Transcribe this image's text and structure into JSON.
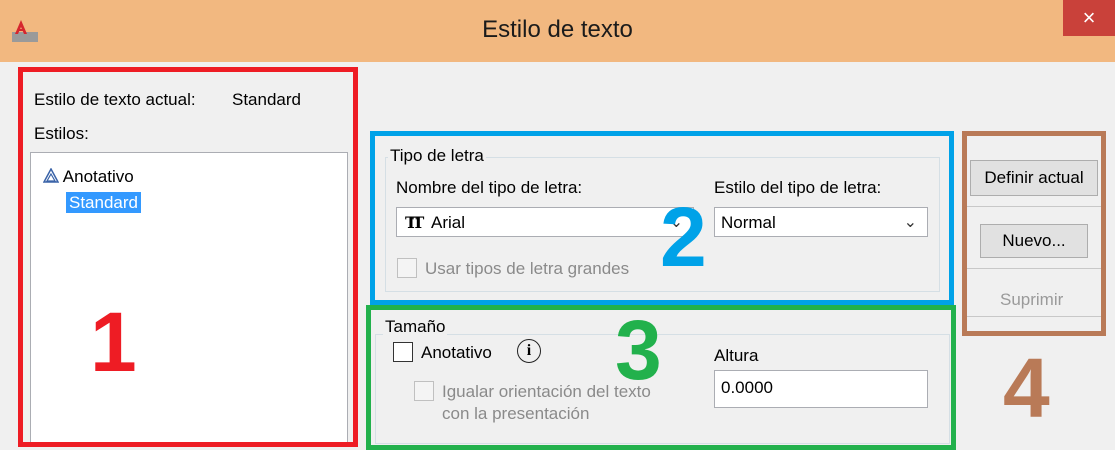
{
  "window": {
    "title": "Estilo de texto",
    "close": "×",
    "accent": "#f2b880"
  },
  "left_panel": {
    "current_style_label": "Estilo de texto actual:",
    "current_style_value": "Standard",
    "styles_label": "Estilos:",
    "styles": [
      "Anotativo",
      "Standard"
    ],
    "selected_style": "Standard"
  },
  "font_group": {
    "legend": "Tipo de letra",
    "font_name_label": "Nombre del tipo de letra:",
    "font_name_value": "Arial",
    "font_style_label": "Estilo del tipo de letra:",
    "font_style_value": "Normal",
    "big_fonts_label": "Usar tipos de letra grandes",
    "big_fonts_checked": false
  },
  "size_group": {
    "legend": "Tamaño",
    "annotative_label": "Anotativo",
    "annotative_checked": false,
    "match_orientation_line1": "Igualar orientación del texto",
    "match_orientation_line2": "con la presentación",
    "height_label": "Altura",
    "height_value": "0.0000"
  },
  "buttons": {
    "set_current": "Definir actual",
    "new": "Nuevo...",
    "delete": "Suprimir"
  },
  "annotations": {
    "n1": "1",
    "n2": "2",
    "n3": "3",
    "n4": "4",
    "color1": "#ee1c24",
    "color2": "#00a2e8",
    "color3": "#22b14c",
    "color4": "#b97a57"
  },
  "icons": [
    "app-icon",
    "close-icon",
    "annotative-icon",
    "truetype-font-icon",
    "chevron-down-icon",
    "info-icon"
  ]
}
